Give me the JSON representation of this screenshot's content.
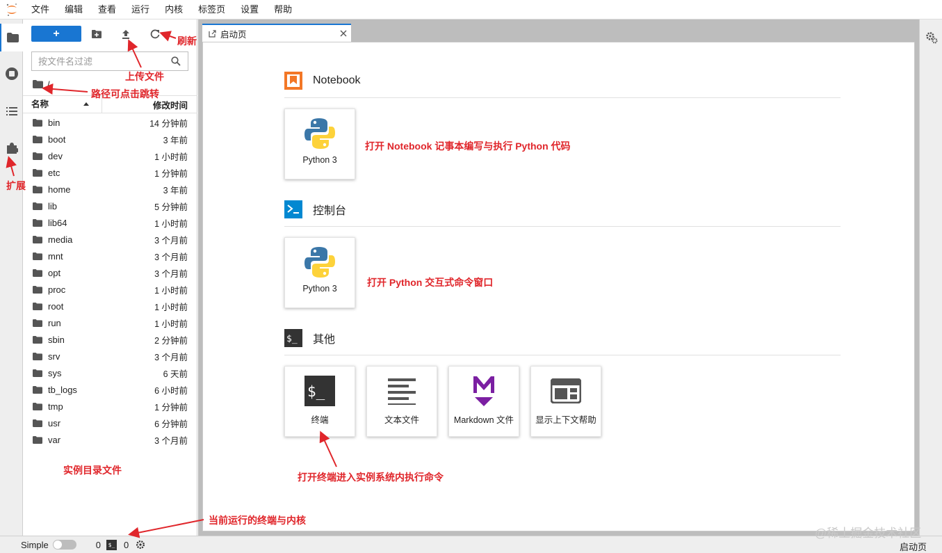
{
  "menubar": {
    "items": [
      "文件",
      "编辑",
      "查看",
      "运行",
      "内核",
      "标签页",
      "设置",
      "帮助"
    ]
  },
  "filebrowser": {
    "new_label": "+",
    "filter_placeholder": "按文件名过滤",
    "path": "/",
    "header_name": "名称",
    "header_modified": "修改时间",
    "files": [
      {
        "name": "bin",
        "modified": "14 分钟前"
      },
      {
        "name": "boot",
        "modified": "3 年前"
      },
      {
        "name": "dev",
        "modified": "1 小时前"
      },
      {
        "name": "etc",
        "modified": "1 分钟前"
      },
      {
        "name": "home",
        "modified": "3 年前"
      },
      {
        "name": "lib",
        "modified": "5 分钟前"
      },
      {
        "name": "lib64",
        "modified": "1 小时前"
      },
      {
        "name": "media",
        "modified": "3 个月前"
      },
      {
        "name": "mnt",
        "modified": "3 个月前"
      },
      {
        "name": "opt",
        "modified": "3 个月前"
      },
      {
        "name": "proc",
        "modified": "1 小时前"
      },
      {
        "name": "root",
        "modified": "1 小时前"
      },
      {
        "name": "run",
        "modified": "1 小时前"
      },
      {
        "name": "sbin",
        "modified": "2 分钟前"
      },
      {
        "name": "srv",
        "modified": "3 个月前"
      },
      {
        "name": "sys",
        "modified": "6 天前"
      },
      {
        "name": "tb_logs",
        "modified": "6 小时前"
      },
      {
        "name": "tmp",
        "modified": "1 分钟前"
      },
      {
        "name": "usr",
        "modified": "6 分钟前"
      },
      {
        "name": "var",
        "modified": "3 个月前"
      }
    ]
  },
  "tab": {
    "label": "启动页"
  },
  "launcher": {
    "notebook": {
      "title": "Notebook",
      "card_label": "Python 3"
    },
    "console": {
      "title": "控制台",
      "card_label": "Python 3"
    },
    "other": {
      "title": "其他",
      "cards": [
        "终端",
        "文本文件",
        "Markdown 文件",
        "显示上下文帮助"
      ]
    }
  },
  "statusbar": {
    "mode_label": "Simple",
    "terminals_count": "0",
    "kernels_count": "0",
    "right_label": "启动页"
  },
  "annotations": {
    "refresh": "刷新",
    "upload": "上传文件",
    "path_jump": "路径可点击跳转",
    "extensions": "扩展",
    "instance_files": "实例目录文件",
    "running": "当前运行的终端与内核",
    "notebook_desc": "打开 Notebook 记事本编写与执行 Python 代码",
    "console_desc": "打开 Python 交互式命令窗口",
    "terminal_desc": "打开终端进入实例系统内执行命令"
  },
  "watermark": "@稀土掘金技术社区",
  "colors": {
    "accent": "#1976d2",
    "annotation": "#e0262b",
    "notebook_icon": "#f37726",
    "console_icon": "#0288d1",
    "markdown_icon": "#7b1fa2"
  }
}
